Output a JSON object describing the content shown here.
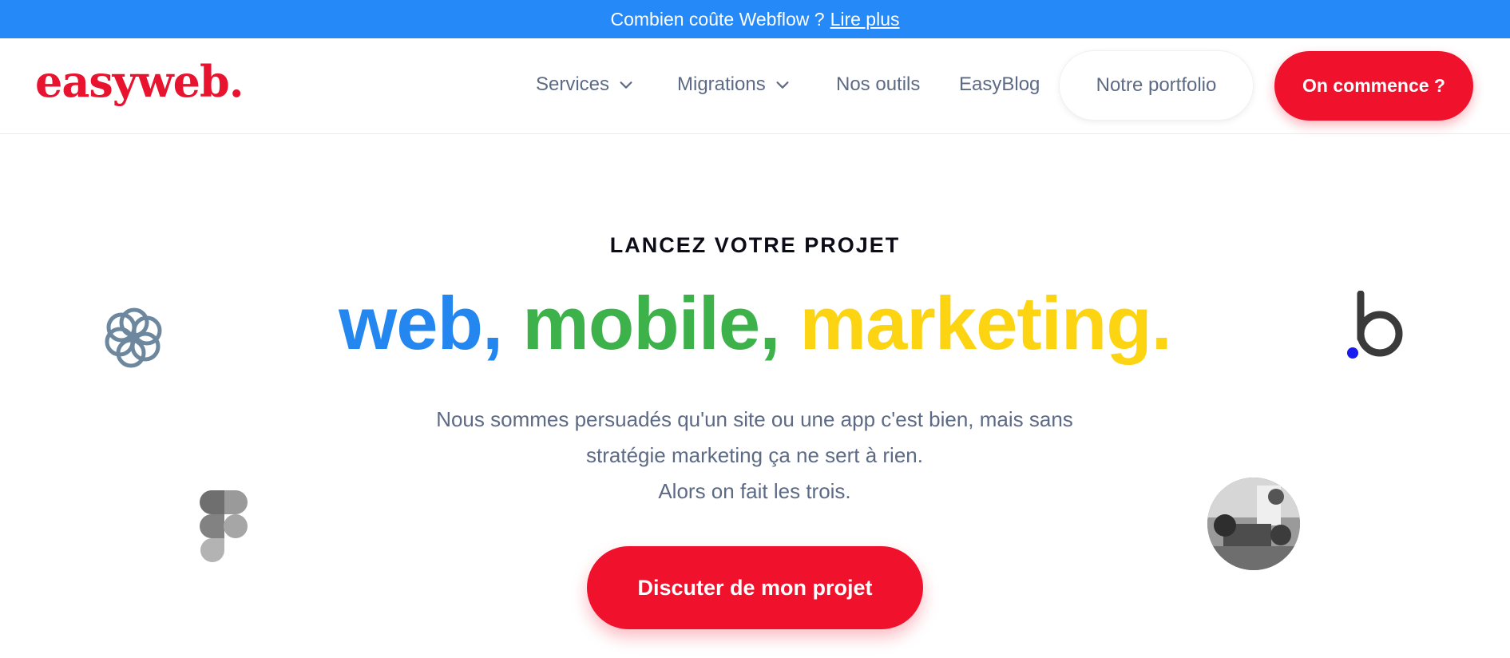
{
  "banner": {
    "text": "Combien coûte Webflow ?",
    "link_label": "Lire plus",
    "background": "#2589f7"
  },
  "header": {
    "logo_text": "easyweb.",
    "nav": {
      "services": "Services",
      "migrations": "Migrations",
      "tools": "Nos outils",
      "blog": "EasyBlog"
    },
    "portfolio_label": "Notre portfolio",
    "cta_label": "On commence ?"
  },
  "hero": {
    "eyebrow": "LANCEZ VOTRE PROJET",
    "headline": {
      "web": "web",
      "comma1": ",",
      "mobile": "mobile",
      "comma2": ",",
      "marketing": "marketing",
      "period": "."
    },
    "subtext_line1": "Nous sommes persuadés qu'un site ou une app c'est bien, mais sans",
    "subtext_line2": "stratégie marketing ça ne sert à rien.",
    "subtext_line3": "Alors on fait les trois.",
    "cta_label": "Discuter de mon projet"
  },
  "decorations": {
    "left_top_icon": "sendinblue-logo-icon",
    "left_bottom_icon": "figma-logo-icon",
    "right_top_icon": "bubble-logo-icon",
    "right_bottom_icon": "team-photo"
  },
  "colors": {
    "brand_red": "#f0112c",
    "web_blue": "#2487f0",
    "mobile_green": "#3db24b",
    "marketing_yellow": "#fcd412",
    "text_muted": "#5d6a85"
  }
}
